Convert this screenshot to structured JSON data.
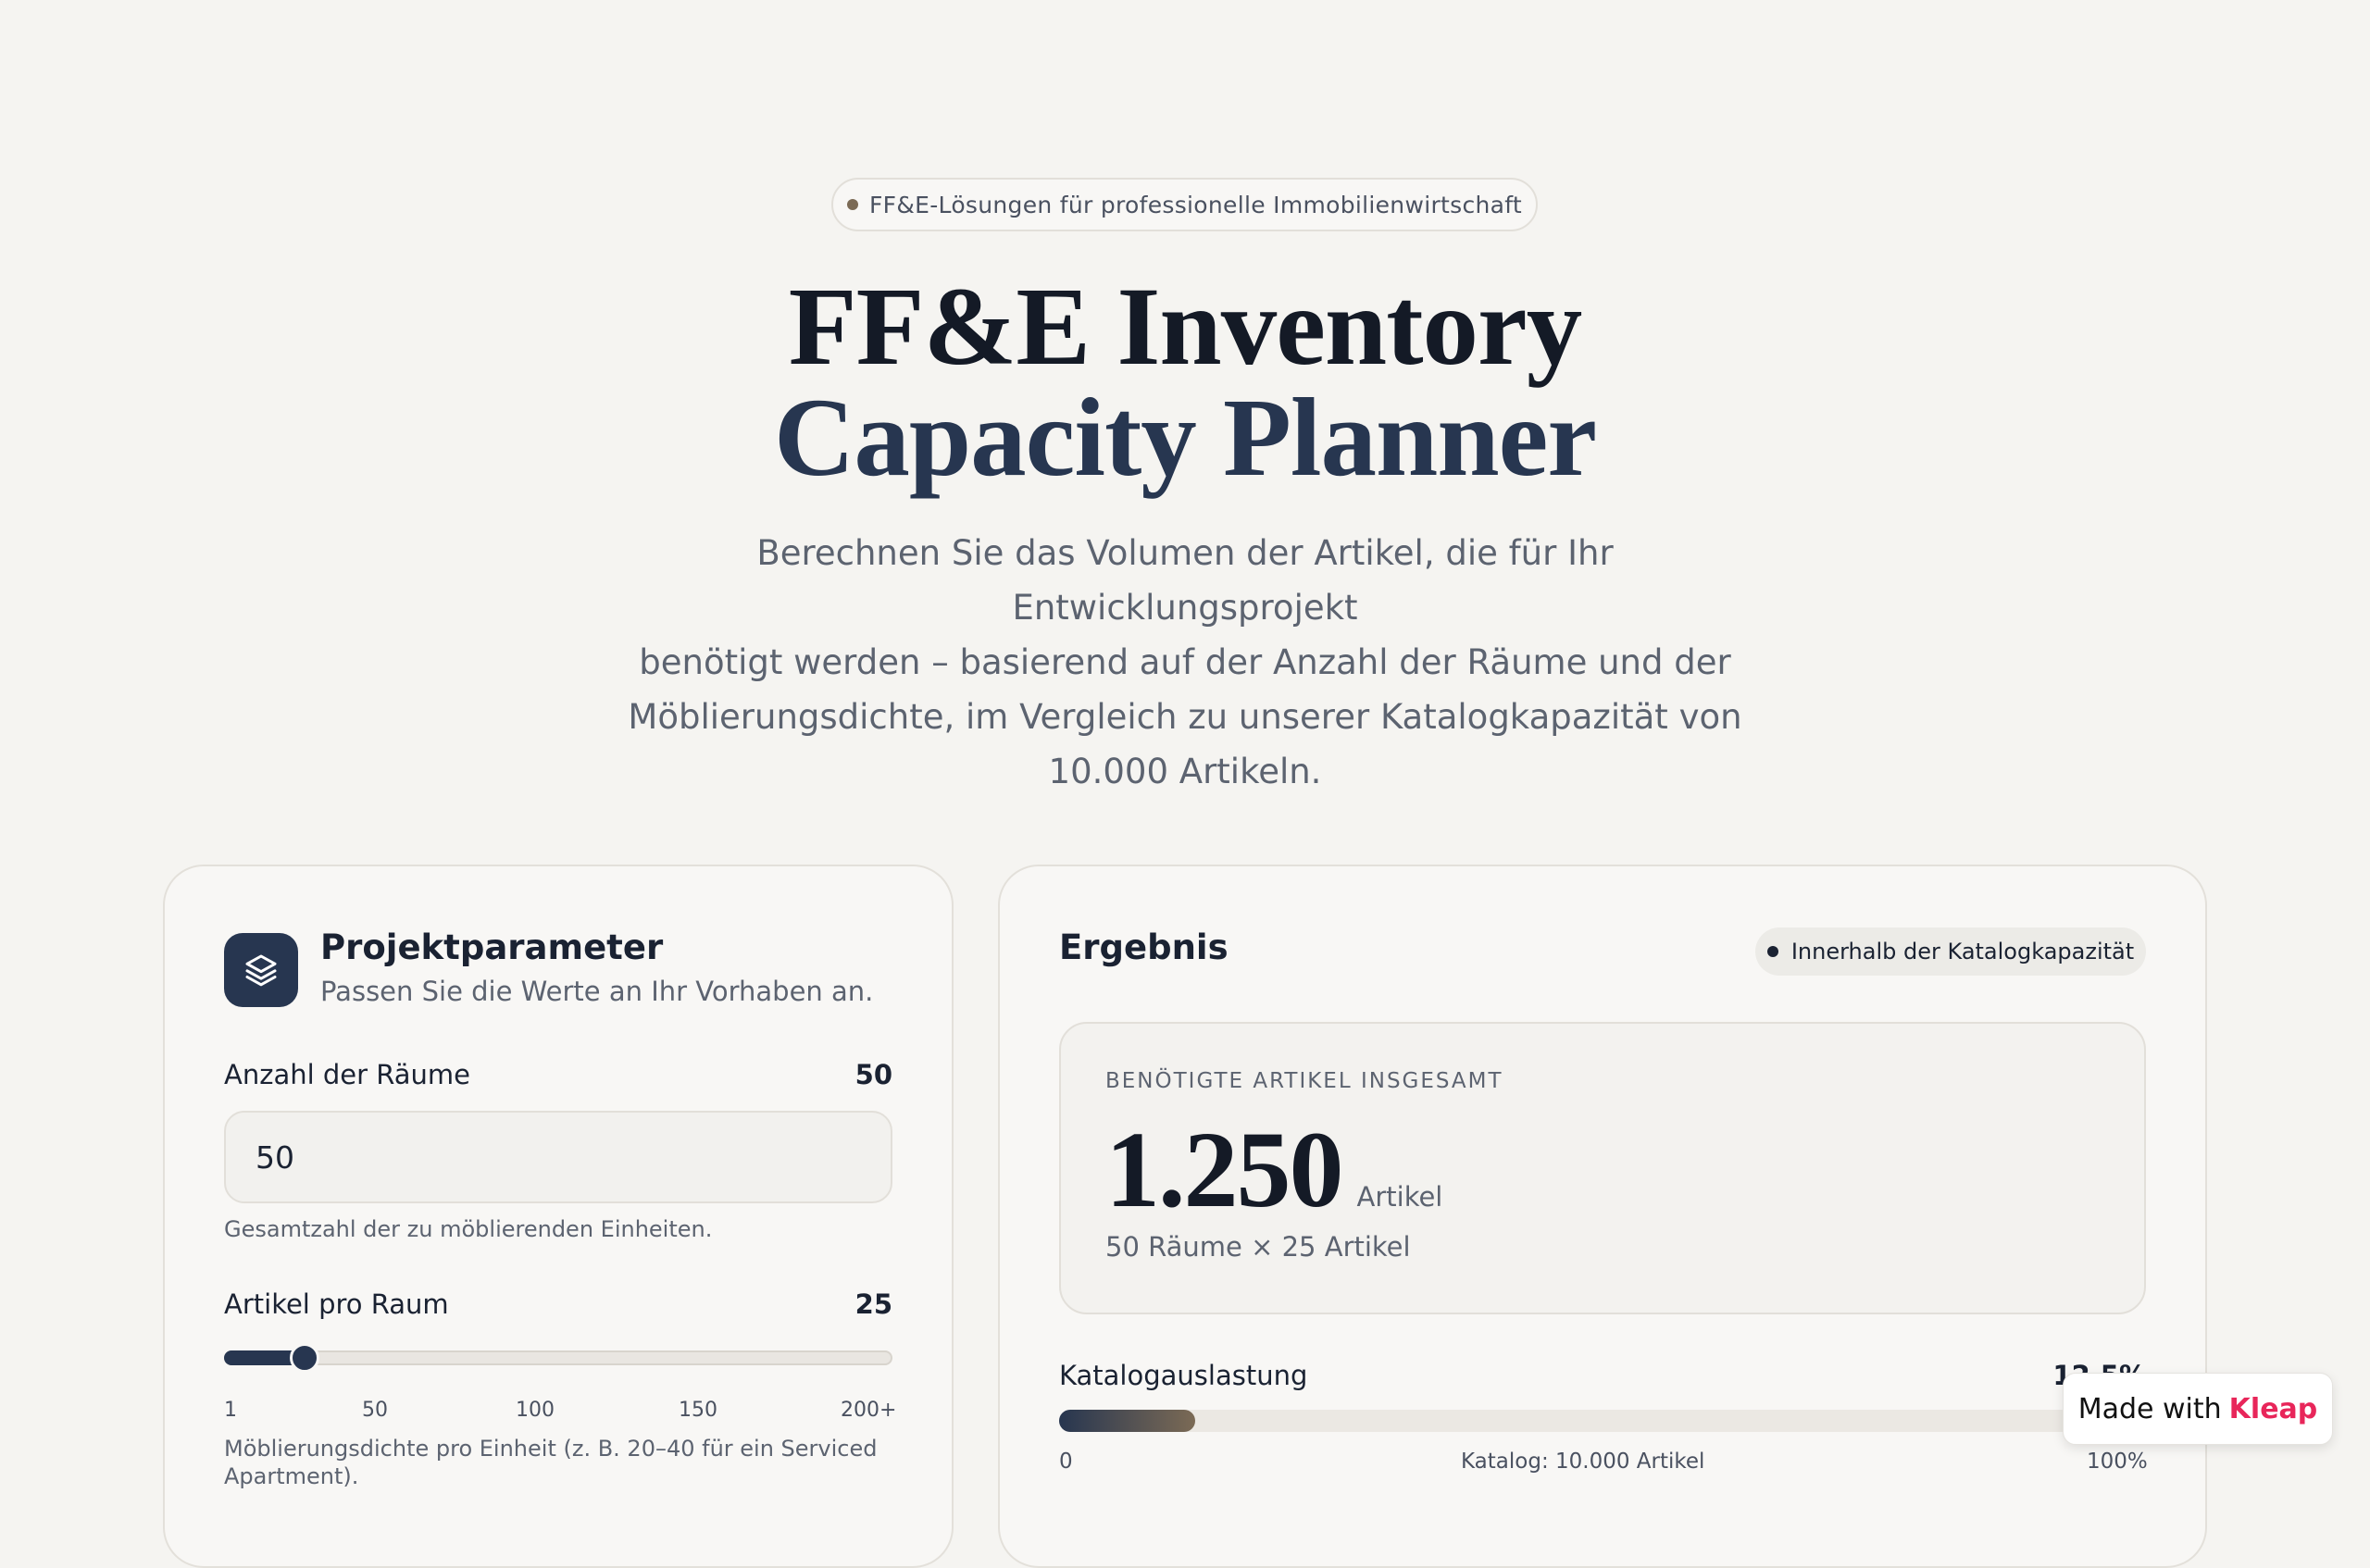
{
  "hero": {
    "badge": "FF&E-Lösungen für professionelle Immobilienwirtschaft",
    "title_line1": "FF&E Inventory",
    "title_line2": "Capacity Planner",
    "subtitle_lines": [
      "Berechnen Sie das Volumen der Artikel, die für Ihr Entwicklungsprojekt",
      "benötigt werden – basierend auf der Anzahl der Räume und der",
      "Möblierungsdichte, im Vergleich zu unserer Katalogkapazität von",
      "10.000 Artikeln."
    ]
  },
  "params": {
    "title": "Projektparameter",
    "description": "Passen Sie die Werte an Ihr Vorhaben an.",
    "icon": "layers-icon",
    "rooms": {
      "label": "Anzahl der Räume",
      "value_display": "50",
      "input_value": "50",
      "hint": "Gesamtzahl der zu möblierenden Einheiten."
    },
    "items_per_room": {
      "label": "Artikel pro Raum",
      "value_display": "25",
      "slider_fraction": 0.1206,
      "ticks": [
        "1",
        "50",
        "100",
        "150",
        "200+"
      ],
      "hint_line1": "Möblierungsdichte pro Einheit (z. B. 20–40 für ein Serviced",
      "hint_line2": "Apartment)."
    }
  },
  "result": {
    "title": "Ergebnis",
    "status": "Innerhalb der Katalogkapazität",
    "total_label": "BENÖTIGTE ARTIKEL INSGESAMT",
    "total_value": "1.250",
    "total_unit": "Artikel",
    "formula": "50 Räume × 25 Artikel",
    "utilization": {
      "label": "Katalogauslastung",
      "percent_display": "12,5%",
      "fraction": 0.125,
      "min_label": "0",
      "center_label": "Katalog: 10.000 Artikel",
      "max_label": "100%"
    }
  },
  "made_with": {
    "prefix": "Made with",
    "brand": "Kleap"
  },
  "colors": {
    "background": "#f5f4f1",
    "navy": "#273650",
    "accent_brown": "#7b6a55",
    "kleap_pink": "#e8265a"
  }
}
